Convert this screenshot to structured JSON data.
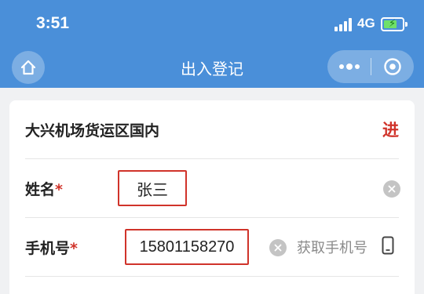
{
  "status": {
    "time": "3:51",
    "network": "4G"
  },
  "nav": {
    "title": "出入登记"
  },
  "form": {
    "location": "大兴机场货运区国内",
    "direction": "进",
    "name_label": "姓名",
    "name_value": "张三",
    "phone_label": "手机号",
    "phone_value": "15801158270",
    "get_phone_label": "获取手机号",
    "required_mark": "*"
  },
  "colors": {
    "nav_bg": "#4a8fd9",
    "accent_red": "#d0332a",
    "page_bg": "#f0f1f3"
  }
}
